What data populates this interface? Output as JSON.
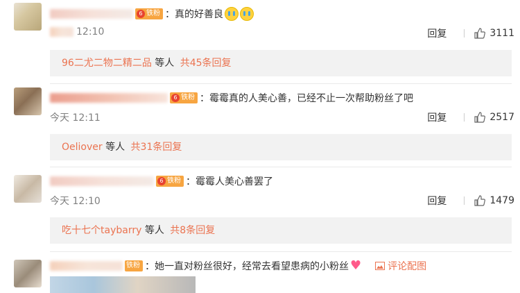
{
  "comments": [
    {
      "text": "：真的好善良",
      "time": "12:10",
      "reply_label": "回复",
      "likes": "3111",
      "more_name": "96二尤二物二精二品",
      "more_people": "等人",
      "more_count": "共45条回复"
    },
    {
      "text": "：霉霉真的人美心善，已经不止一次帮助粉丝了吧",
      "time": "今天 12:11",
      "reply_label": "回复",
      "likes": "2517",
      "more_name": "Oeliover",
      "more_people": "等人",
      "more_count": "共31条回复"
    },
    {
      "text": "：霉霉人美心善罢了",
      "time": "今天 12:10",
      "reply_label": "回复",
      "likes": "1479",
      "more_name": "吃十七个taybarry",
      "more_people": "等人",
      "more_count": "共8条回复"
    },
    {
      "text": "：她一直对粉丝很好，经常去看望患病的小粉丝",
      "pic_link": "评论配图"
    }
  ],
  "badge_label": "铁粉",
  "badge_num": "6",
  "colors": {
    "accent": "#eb7350",
    "badge": "#f7a541",
    "muted": "#808080",
    "bar": "#f2f2f2"
  },
  "icons": {
    "like": "thumbs-up-icon",
    "picture": "image-icon",
    "emoji_cry": "crying-face-icon",
    "emoji_heart": "heart-icon"
  }
}
